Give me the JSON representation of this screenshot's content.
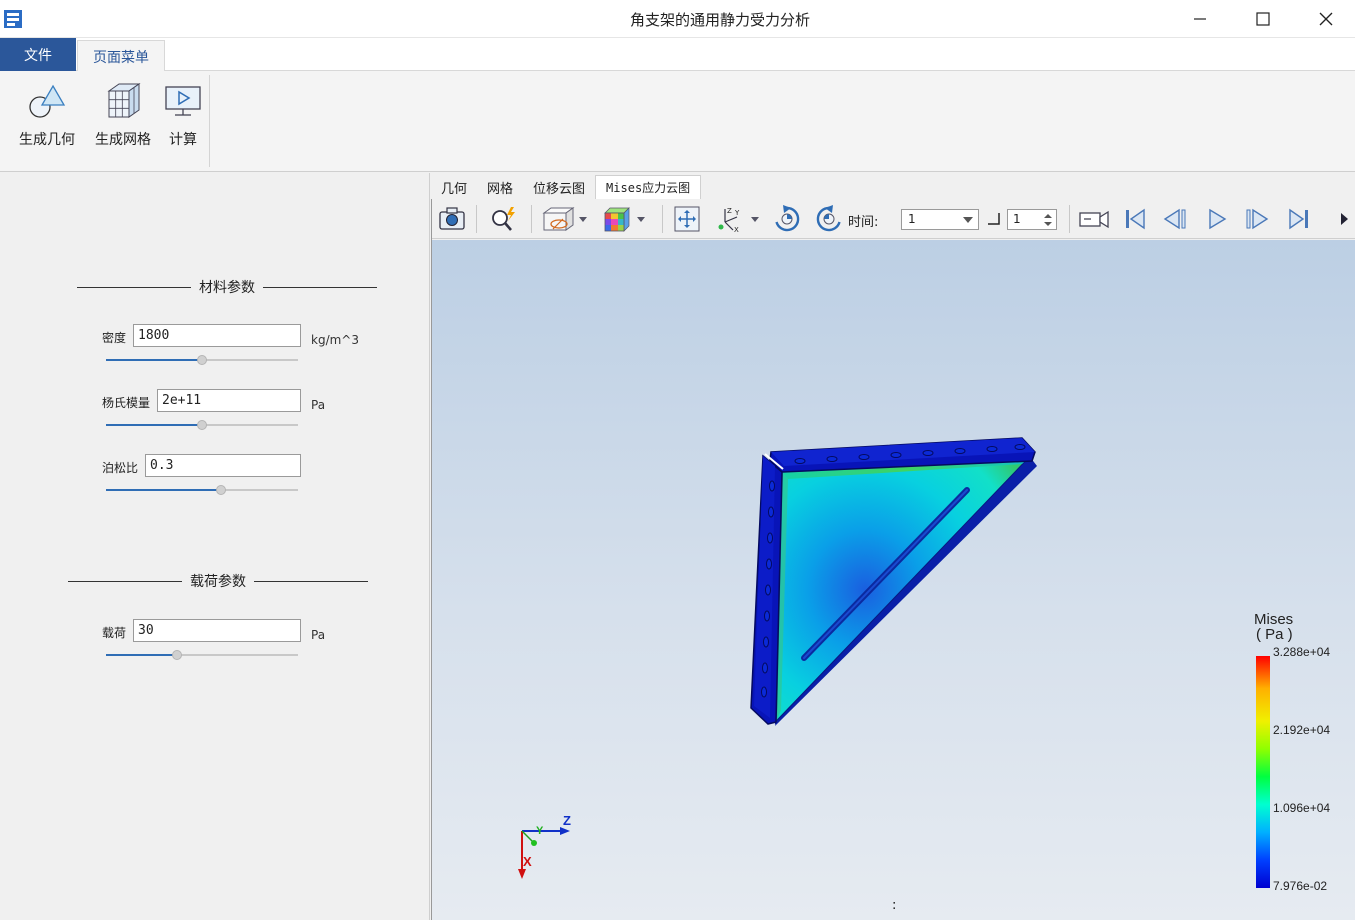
{
  "window": {
    "title": "角支架的通用静力受力分析"
  },
  "menu": {
    "file_tab": "文件",
    "page_tab": "页面菜单"
  },
  "ribbon": {
    "buttons": [
      {
        "label": "生成几何",
        "icon": "geometry-icon"
      },
      {
        "label": "生成网格",
        "icon": "mesh-icon"
      },
      {
        "label": "计算",
        "icon": "compute-icon"
      }
    ]
  },
  "material": {
    "title": "材料参数",
    "density": {
      "label": "密度",
      "value": "1800",
      "unit": "kg/m^3",
      "slider_fraction": 0.5
    },
    "youngs": {
      "label": "杨氏模量",
      "value": "2e+11",
      "unit": "Pa",
      "slider_fraction": 0.5
    },
    "poisson": {
      "label": "泊松比",
      "value": "0.3",
      "unit": "",
      "slider_fraction": 0.6
    }
  },
  "load": {
    "title": "载荷参数",
    "load": {
      "label": "载荷",
      "value": "30",
      "unit": "Pa",
      "slider_fraction": 0.37
    }
  },
  "tabs": [
    "几何",
    "网格",
    "位移云图",
    "Mises应力云图"
  ],
  "active_tab": "Mises应力云图",
  "toolbar": {
    "time_label": "时间:",
    "time_value": "1",
    "step_value": "1",
    "icons": [
      "camera-icon",
      "zoom-icon",
      "display-mode-icon",
      "colormap-icon",
      "fit-view-icon",
      "axes-icon",
      "rotate-cw-icon",
      "rotate-ccw-icon",
      "record-icon",
      "first-frame-icon",
      "prev-frame-icon",
      "play-icon",
      "next-frame-icon",
      "last-frame-icon"
    ]
  },
  "legend": {
    "title_line1": "Mises",
    "title_line2": "( Pa )",
    "max": "3.288e+04",
    "mid_high": "2.192e+04",
    "mid_low": "1.096e+04",
    "min": "7.976e-02"
  },
  "axes": {
    "x": "X",
    "y": "Y",
    "z": "Z"
  },
  "status_mark": ":"
}
